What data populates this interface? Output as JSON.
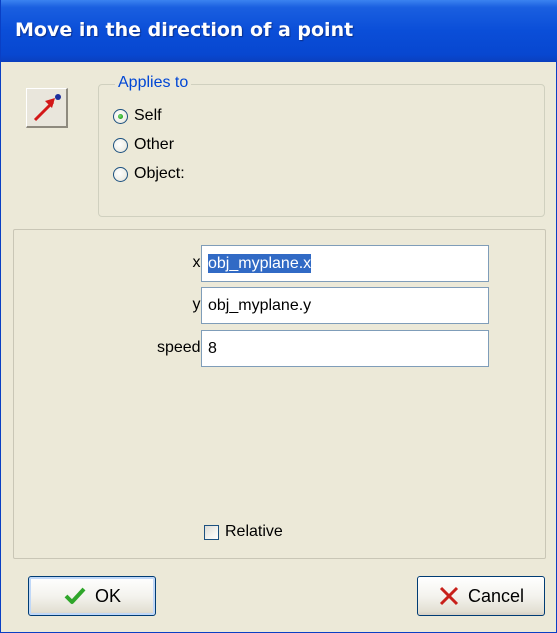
{
  "window": {
    "title": "Move in the direction of a point"
  },
  "action_icon": {
    "name": "move-towards-point-icon"
  },
  "applies_to": {
    "legend": "Applies to",
    "options": [
      {
        "label": "Self",
        "selected": true
      },
      {
        "label": "Other",
        "selected": false
      },
      {
        "label": "Object:",
        "selected": false
      }
    ]
  },
  "fields": [
    {
      "label": "x:",
      "value": "obj_myplane.x",
      "selected_text": true
    },
    {
      "label": "y:",
      "value": "obj_myplane.y",
      "selected_text": false
    },
    {
      "label": "speed:",
      "value": "8",
      "selected_text": false
    }
  ],
  "relative": {
    "label": "Relative",
    "checked": false
  },
  "buttons": {
    "ok": "OK",
    "cancel": "Cancel"
  },
  "colors": {
    "title_bar": "#0a4ed8",
    "legend_text": "#0046d5",
    "selection": "#316ac5",
    "ok_check": "#2fa62a",
    "cancel_x": "#c8201a"
  }
}
